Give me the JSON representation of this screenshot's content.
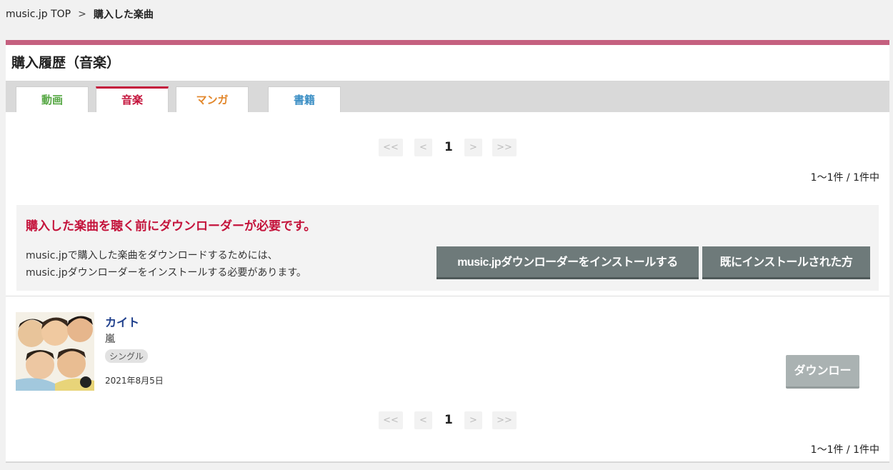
{
  "breadcrumb": {
    "home": "music.jp TOP",
    "separator": ">",
    "current": "購入した楽曲"
  },
  "page_title": "購入履歴（音楽）",
  "tabs": [
    {
      "label": "動画",
      "active": false
    },
    {
      "label": "音楽",
      "active": true
    },
    {
      "label": "マンガ",
      "active": false
    },
    {
      "label": "書籍",
      "active": false
    }
  ],
  "pager": {
    "first": "<<",
    "prev": "<",
    "current": "1",
    "next": ">",
    "last": ">>"
  },
  "count_text": "1〜1件 / 1件中",
  "notice": {
    "title": "購入した楽曲を聴く前にダウンローダーが必要です。",
    "line1": "music.jpで購入した楽曲をダウンロードするためには、",
    "line2": "music.jpダウンローダーをインストールする必要があります。",
    "install_button": "music.jpダウンローダーをインストールする",
    "installed_button": "既にインストールされた方"
  },
  "items": [
    {
      "title": "カイト",
      "artist": "嵐",
      "type": "シングル",
      "date": "2021年8月5日",
      "download_label": "ダウンロード"
    }
  ],
  "colors": {
    "accent_pink": "#c5607f",
    "music_red": "#c4133b",
    "video_green": "#57a845",
    "manga_orange": "#e2862a",
    "books_blue": "#3a8ec4",
    "button_dark": "#6e7a7a",
    "button_disabled": "#aab2b2"
  }
}
